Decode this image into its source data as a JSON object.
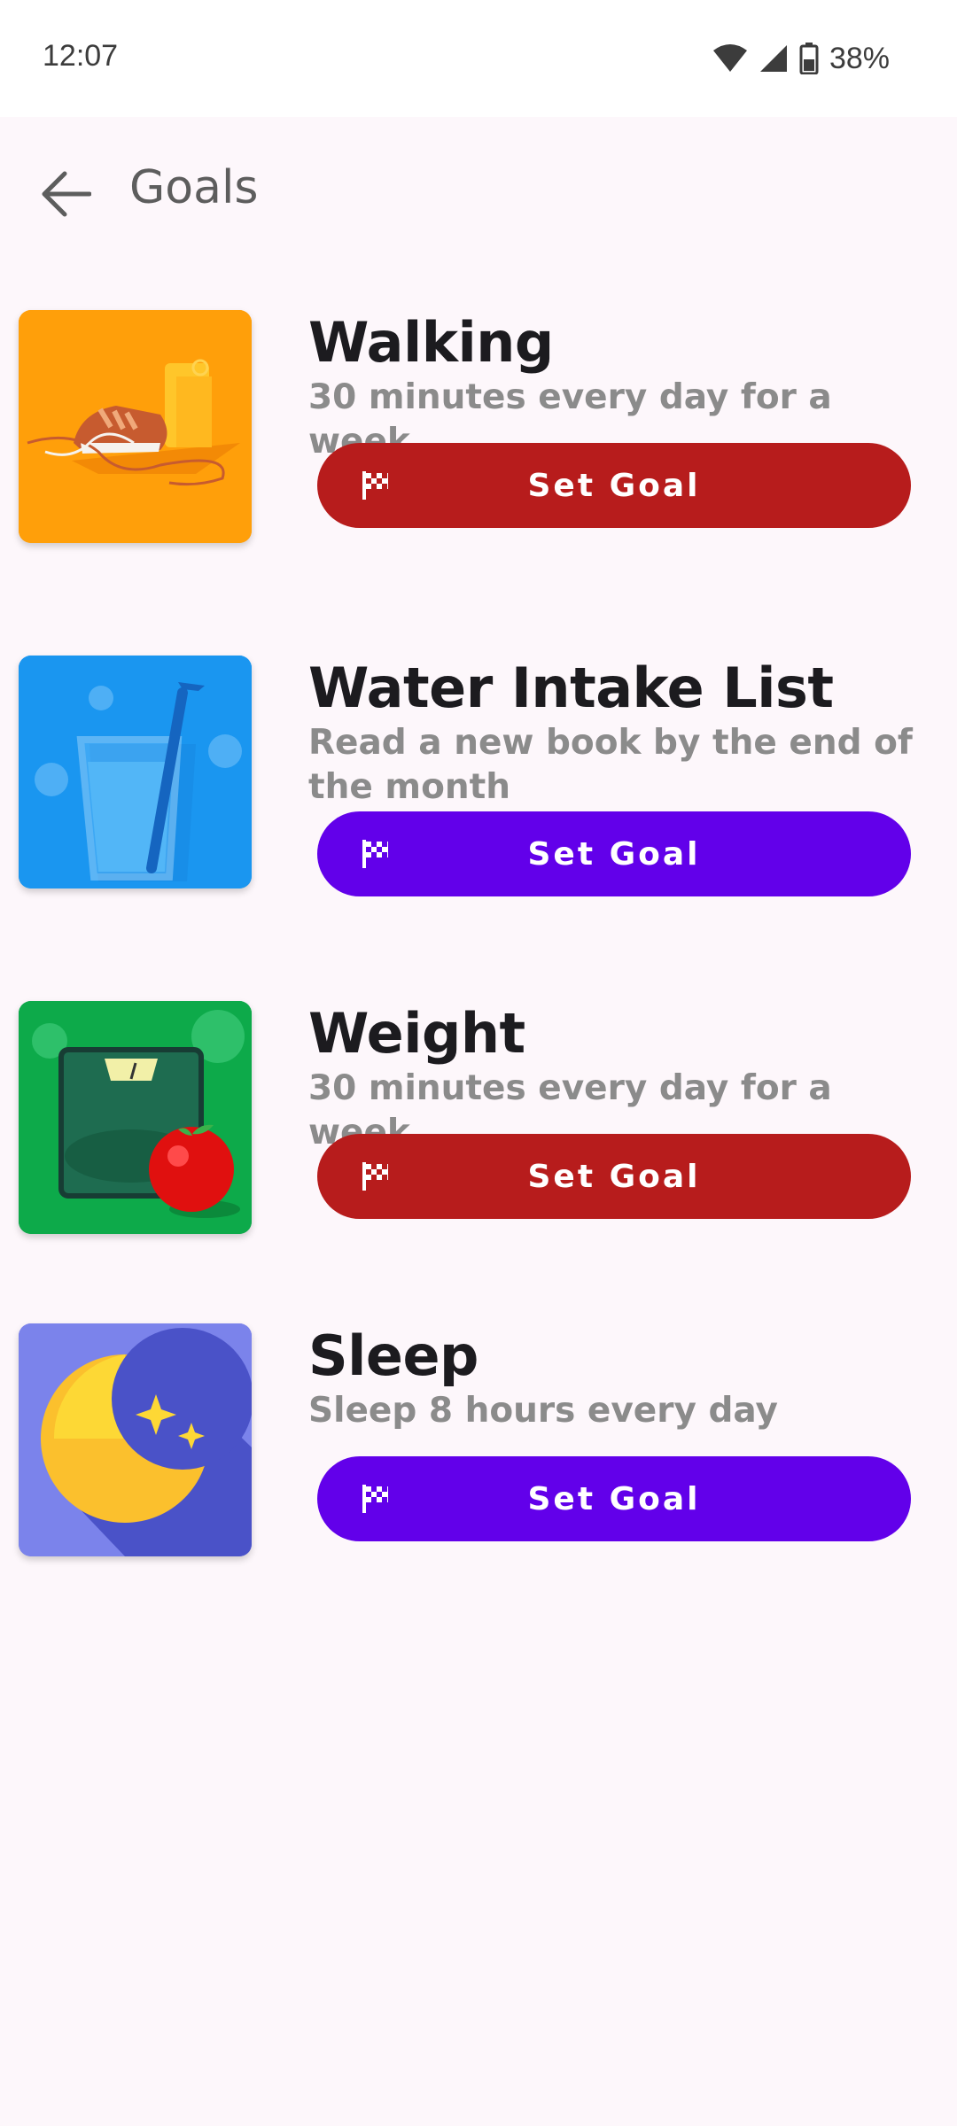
{
  "status_bar": {
    "time": "12:07",
    "battery": "38%",
    "icons": [
      "wifi-icon",
      "signal-icon",
      "battery-icon"
    ]
  },
  "app_bar": {
    "title": "Goals",
    "back_icon": "arrow-back-icon"
  },
  "colors": {
    "red_button": "#b71c1c",
    "purple_button": "#6200ea",
    "walking_bg": "#ff9f0a",
    "water_bg": "#1a96f0",
    "weight_bg": "#0daa4a",
    "sleep_bg": "#7b83eb"
  },
  "goals": [
    {
      "title": "Walking",
      "description": "30 minutes every day for a week",
      "button_label": "Set Goal",
      "button_color": "#b71c1c",
      "icon": "walking-shoe-icon"
    },
    {
      "title": "Water Intake List",
      "description": "Read a new book by the end of the month",
      "button_label": "Set Goal",
      "button_color": "#6200ea",
      "icon": "water-glass-icon"
    },
    {
      "title": "Weight",
      "description": "30 minutes every day for a week",
      "button_label": "Set Goal",
      "button_color": "#b71c1c",
      "icon": "weight-scale-icon"
    },
    {
      "title": "Sleep",
      "description": "Sleep 8 hours every day",
      "button_label": "Set Goal",
      "button_color": "#6200ea",
      "icon": "moon-stars-icon"
    }
  ]
}
